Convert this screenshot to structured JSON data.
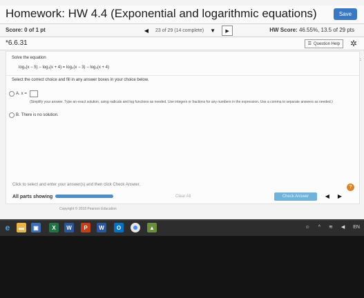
{
  "header": {
    "title": "Homework: HW 4.4 (Exponential and logarithmic equations)",
    "save_label": "Save"
  },
  "scorebar": {
    "score": "Score: 0 of 1 pt",
    "question_nav": "23 of 29 (14 complete)",
    "hw_score_label": "HW Score:",
    "hw_score_value": "46.55%, 13.5 of 29 pts"
  },
  "question": {
    "number": "*6.6.31",
    "help_label": "Question Help"
  },
  "problem": {
    "instruction": "Solve the equation",
    "equation": "log₃(x − 5) − log₃(x + 4) = log₃(x − 3) − log₃(x + 4)",
    "select_text": "Select the correct choice and fill in any answer boxes in your choice below.",
    "choice_a_label": "A.",
    "choice_a_prefix": "x =",
    "choice_a_note": "(Simplify your answer. Type an exact solution, using radicals and log functions as needed. Use integers or fractions for any numbers in the expression. Use a comma to separate answers as needed.)",
    "choice_b_label": "B.",
    "choice_b_text": "There is no solution."
  },
  "footer": {
    "hint": "Click to select and enter your answer(s) and then click Check Answer.",
    "all_parts": "All parts showing",
    "progress": 1.0,
    "clear_all": "Clear All",
    "check_answer": "Check Answer",
    "help_icon": "?"
  },
  "copyright": "Copyright © 2018 Pearson Education",
  "taskbar": {
    "language": "EN",
    "icons": [
      "edge-icon",
      "file-explorer-icon",
      "store-icon",
      "excel-icon",
      "word-icon",
      "powerpoint-icon",
      "word-icon-2",
      "outlook-icon",
      "chrome-icon",
      "photos-icon"
    ]
  },
  "colors": {
    "save_button": "#3a78c2",
    "check_button": "#6fb3dc",
    "help_circle": "#d9852b",
    "progress_fill": "#4c8ec5"
  }
}
